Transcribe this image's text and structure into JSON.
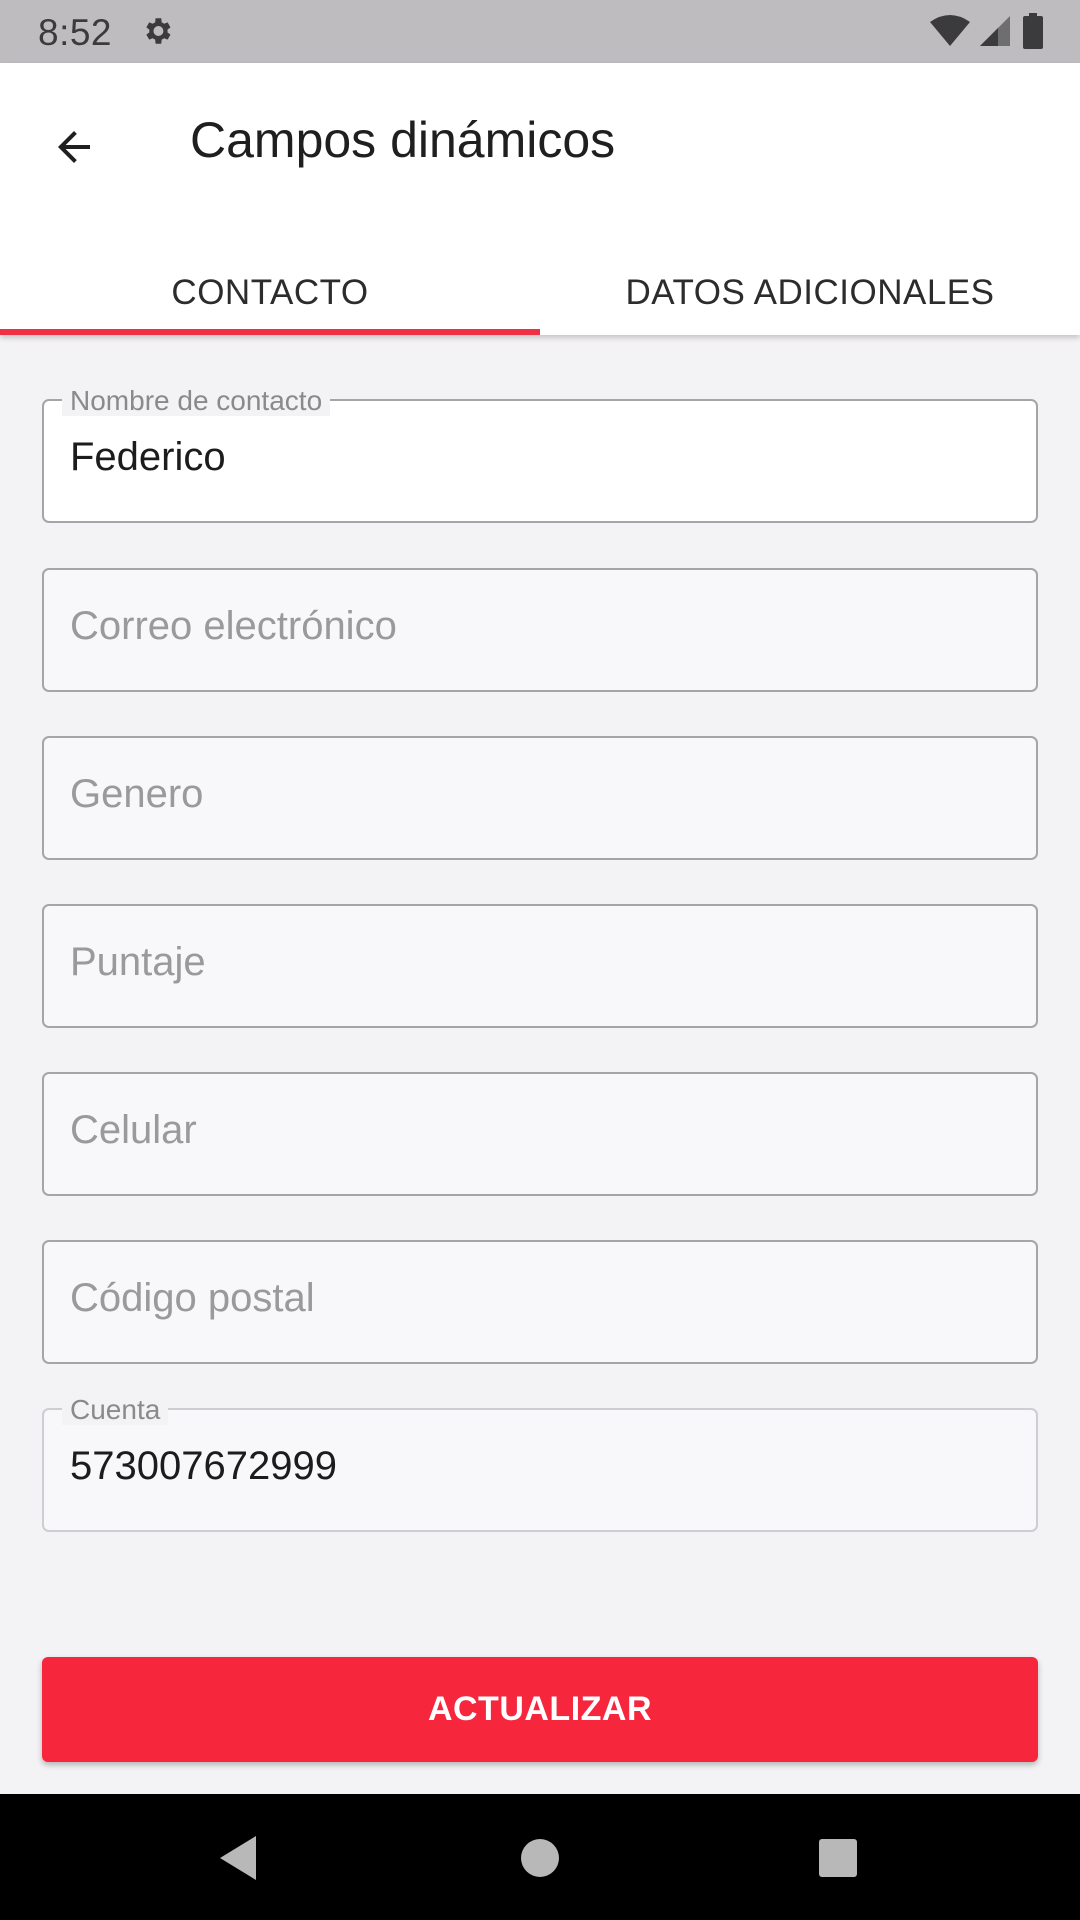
{
  "status_bar": {
    "time": "8:52",
    "icons": [
      "gear-icon",
      "wifi-icon",
      "signal-icon",
      "battery-icon"
    ]
  },
  "app_bar": {
    "title": "Campos dinámicos",
    "back_icon": "arrow-back-icon"
  },
  "tabs": [
    {
      "label": "CONTACTO",
      "selected": true
    },
    {
      "label": "DATOS ADICIONALES",
      "selected": false
    }
  ],
  "form": {
    "contact_name": {
      "label": "Nombre de contacto",
      "value": "Federico"
    },
    "email": {
      "placeholder": "Correo electrónico"
    },
    "gender": {
      "placeholder": "Genero"
    },
    "score": {
      "placeholder": "Puntaje"
    },
    "mobile": {
      "placeholder": "Celular"
    },
    "postal_code": {
      "placeholder": "Código postal"
    },
    "account": {
      "label": "Cuenta",
      "value": "573007672999"
    }
  },
  "update_button": {
    "label": "ACTUALIZAR"
  },
  "nav_bar": {
    "icons": [
      "back-triangle-icon",
      "home-circle-icon",
      "recents-square-icon"
    ]
  },
  "colors": {
    "accent": "#f6263d",
    "tab_indicator": "#ee3145",
    "background": "#f3f2f4",
    "status_bar": "#bebcbf"
  }
}
